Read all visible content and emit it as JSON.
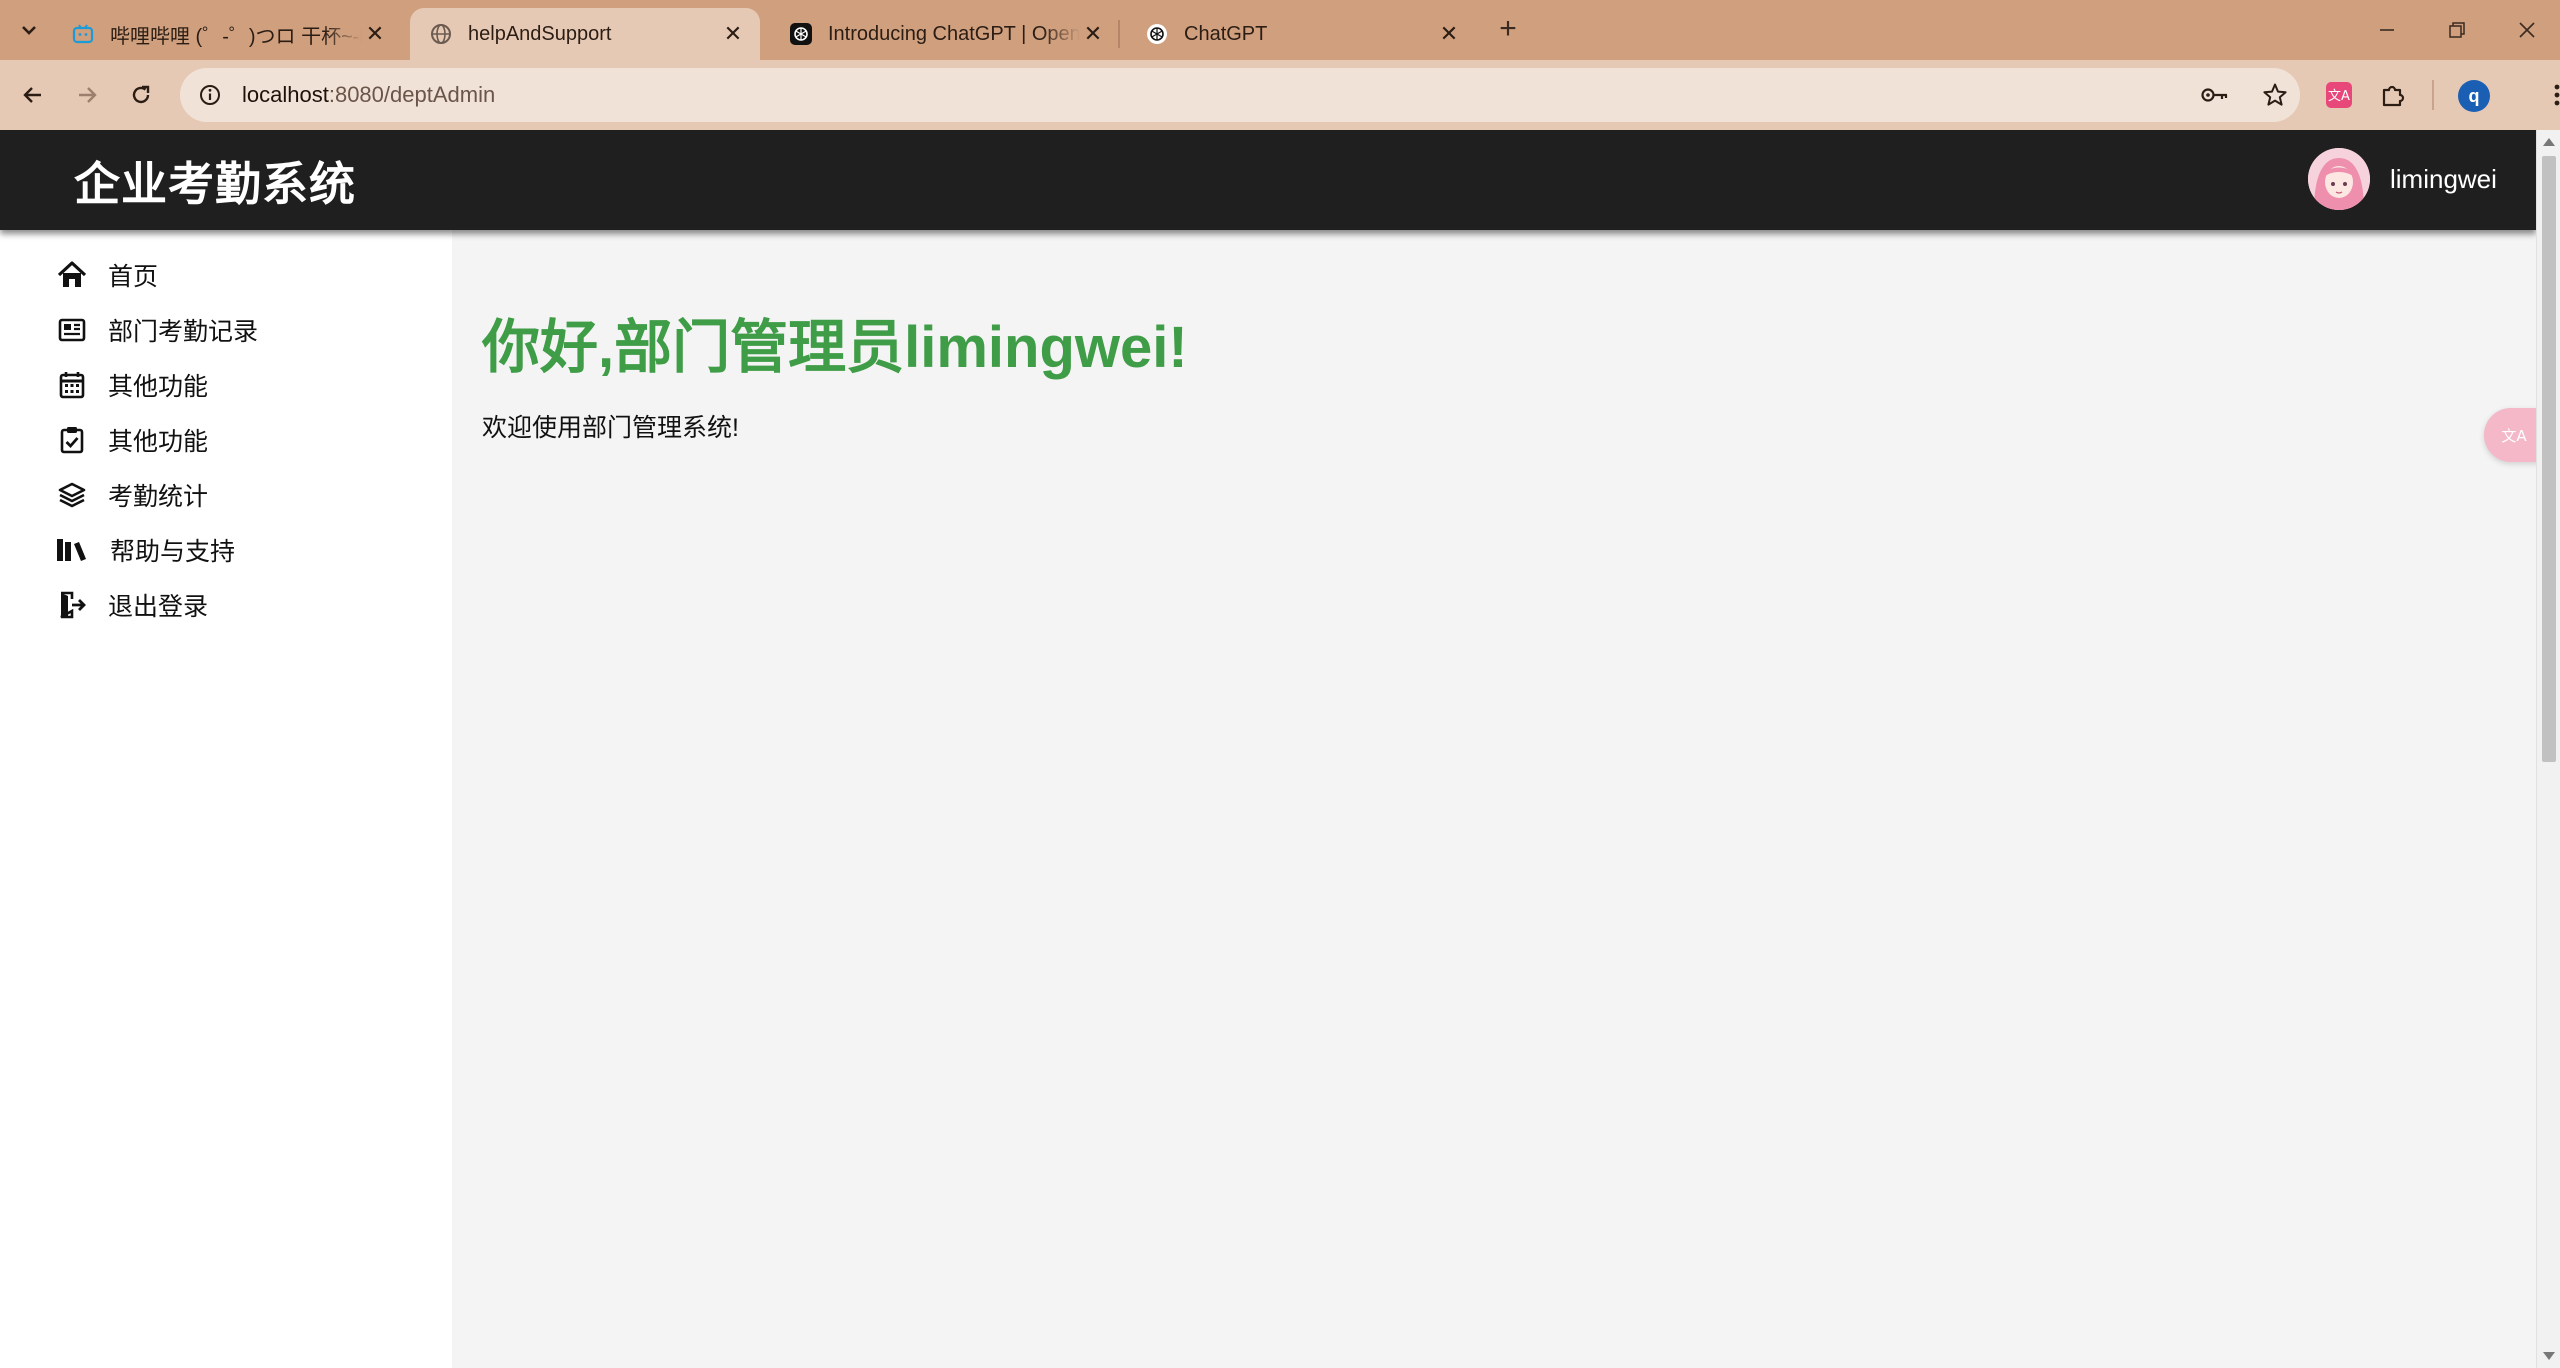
{
  "browser": {
    "tabs": [
      {
        "title": "哔哩哔哩 (゜-゜)つロ 干杯~-bilibili",
        "favicon": "bilibili-icon",
        "active": false
      },
      {
        "title": "helpAndSupport",
        "favicon": "globe-icon",
        "active": true
      },
      {
        "title": "Introducing ChatGPT | OpenAI",
        "favicon": "openai-icon",
        "active": false
      },
      {
        "title": "ChatGPT",
        "favicon": "openai-icon",
        "active": false
      }
    ],
    "address": {
      "host": "localhost",
      "path": ":8080/deptAdmin"
    },
    "profile_initial": "q",
    "colors": {
      "tabstrip": "#cf9f7e",
      "toolbar": "#e6c9b4",
      "omnibox": "#f1e2d8"
    }
  },
  "app": {
    "title": "企业考勤系统",
    "username": "limingwei",
    "colors": {
      "header": "#1f1f1f",
      "greeting": "#3f9c47",
      "main_bg": "#f4f4f4",
      "sidebar_bg": "#ffffff"
    }
  },
  "sidebar": {
    "items": [
      {
        "label": "首页",
        "icon": "home-icon"
      },
      {
        "label": "部门考勤记录",
        "icon": "newspaper-icon"
      },
      {
        "label": "其他功能",
        "icon": "calendar-icon"
      },
      {
        "label": "其他功能",
        "icon": "clipboard-check-icon"
      },
      {
        "label": "考勤统计",
        "icon": "layers-icon"
      },
      {
        "label": "帮助与支持",
        "icon": "books-icon"
      },
      {
        "label": "退出登录",
        "icon": "sign-out-icon"
      }
    ]
  },
  "main": {
    "greeting": "你好,部门管理员limingwei!",
    "welcome": "欢迎使用部门管理系统!"
  }
}
